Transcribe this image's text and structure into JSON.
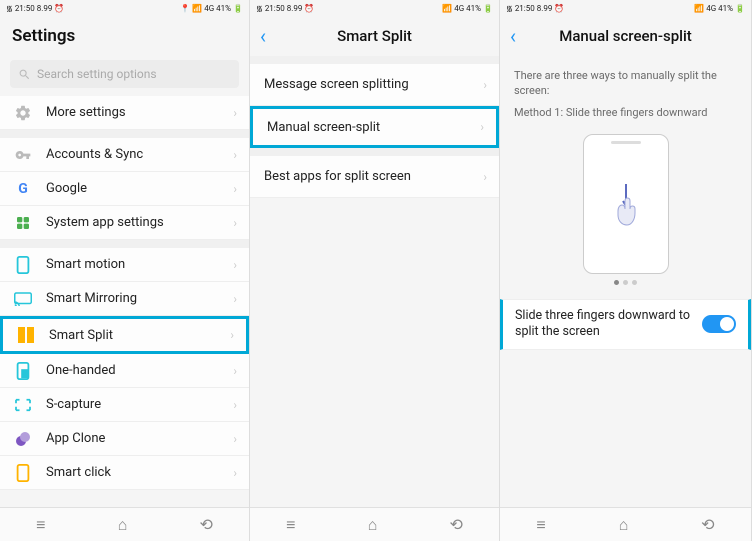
{
  "status": {
    "time": "21:50",
    "date": "8.99",
    "right": "4G 41%"
  },
  "screen1": {
    "title": "Settings",
    "search_placeholder": "Search setting options",
    "items": {
      "more": "More settings",
      "accounts": "Accounts & Sync",
      "google": "Google",
      "sysapp": "System app settings",
      "smartmotion": "Smart motion",
      "mirroring": "Smart Mirroring",
      "smartsplit": "Smart Split",
      "onehanded": "One-handed",
      "scapture": "S-capture",
      "appclone": "App Clone",
      "smartclick": "Smart click"
    }
  },
  "screen2": {
    "title": "Smart Split",
    "items": {
      "msg": "Message screen splitting",
      "manual": "Manual screen-split",
      "best": "Best apps for split screen"
    }
  },
  "screen3": {
    "title": "Manual screen-split",
    "desc1": "There are three ways to manually split the screen:",
    "desc2": "Method 1: Slide three fingers downward",
    "toggle_label": "Slide three fingers downward to split the screen"
  }
}
